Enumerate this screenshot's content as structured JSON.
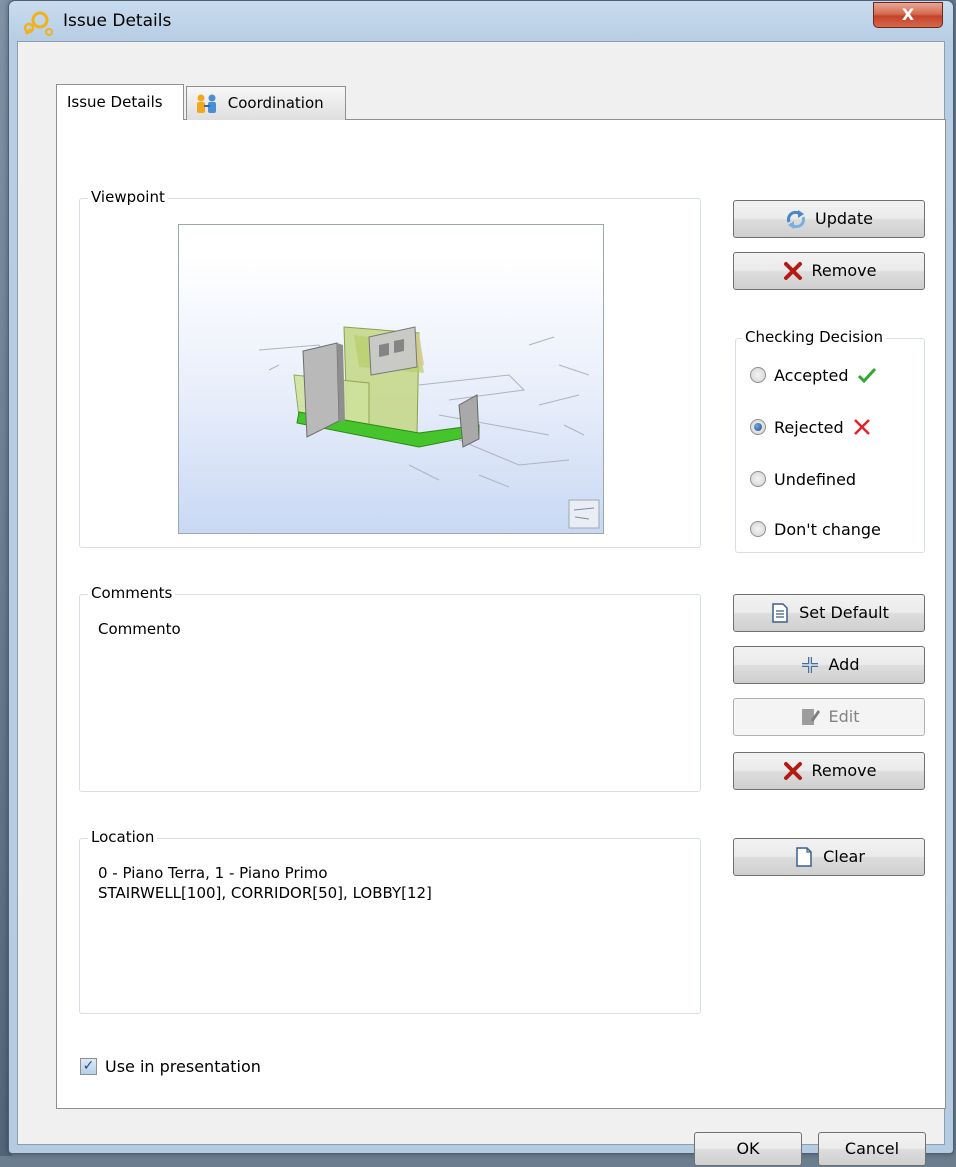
{
  "window": {
    "title": "Issue Details",
    "close_label": "X"
  },
  "tabs": [
    {
      "label": "Issue Details",
      "active": true
    },
    {
      "label": "Coordination",
      "active": false
    }
  ],
  "viewpoint": {
    "label": "Viewpoint",
    "update_label": "Update",
    "remove_label": "Remove"
  },
  "decision": {
    "label": "Checking Decision",
    "options": [
      {
        "label": "Accepted",
        "checked": false,
        "mark": "check-icon"
      },
      {
        "label": "Rejected",
        "checked": true,
        "mark": "x-icon"
      },
      {
        "label": "Undefined",
        "checked": false
      },
      {
        "label": "Don't change",
        "checked": false
      }
    ]
  },
  "comments": {
    "label": "Comments",
    "text": "Commento",
    "set_default_label": "Set Default",
    "add_label": "Add",
    "edit_label": "Edit",
    "remove_label": "Remove"
  },
  "location": {
    "label": "Location",
    "text": "0 - Piano Terra, 1 - Piano Primo\nSTAIRWELL[100], CORRIDOR[50], LOBBY[12]",
    "clear_label": "Clear"
  },
  "presentation": {
    "label": "Use in presentation",
    "checked": true
  },
  "footer": {
    "ok_label": "OK",
    "cancel_label": "Cancel"
  },
  "colors": {
    "accept": "#2fa82f",
    "reject": "#e0232b",
    "remove_x": "#b31b12"
  }
}
